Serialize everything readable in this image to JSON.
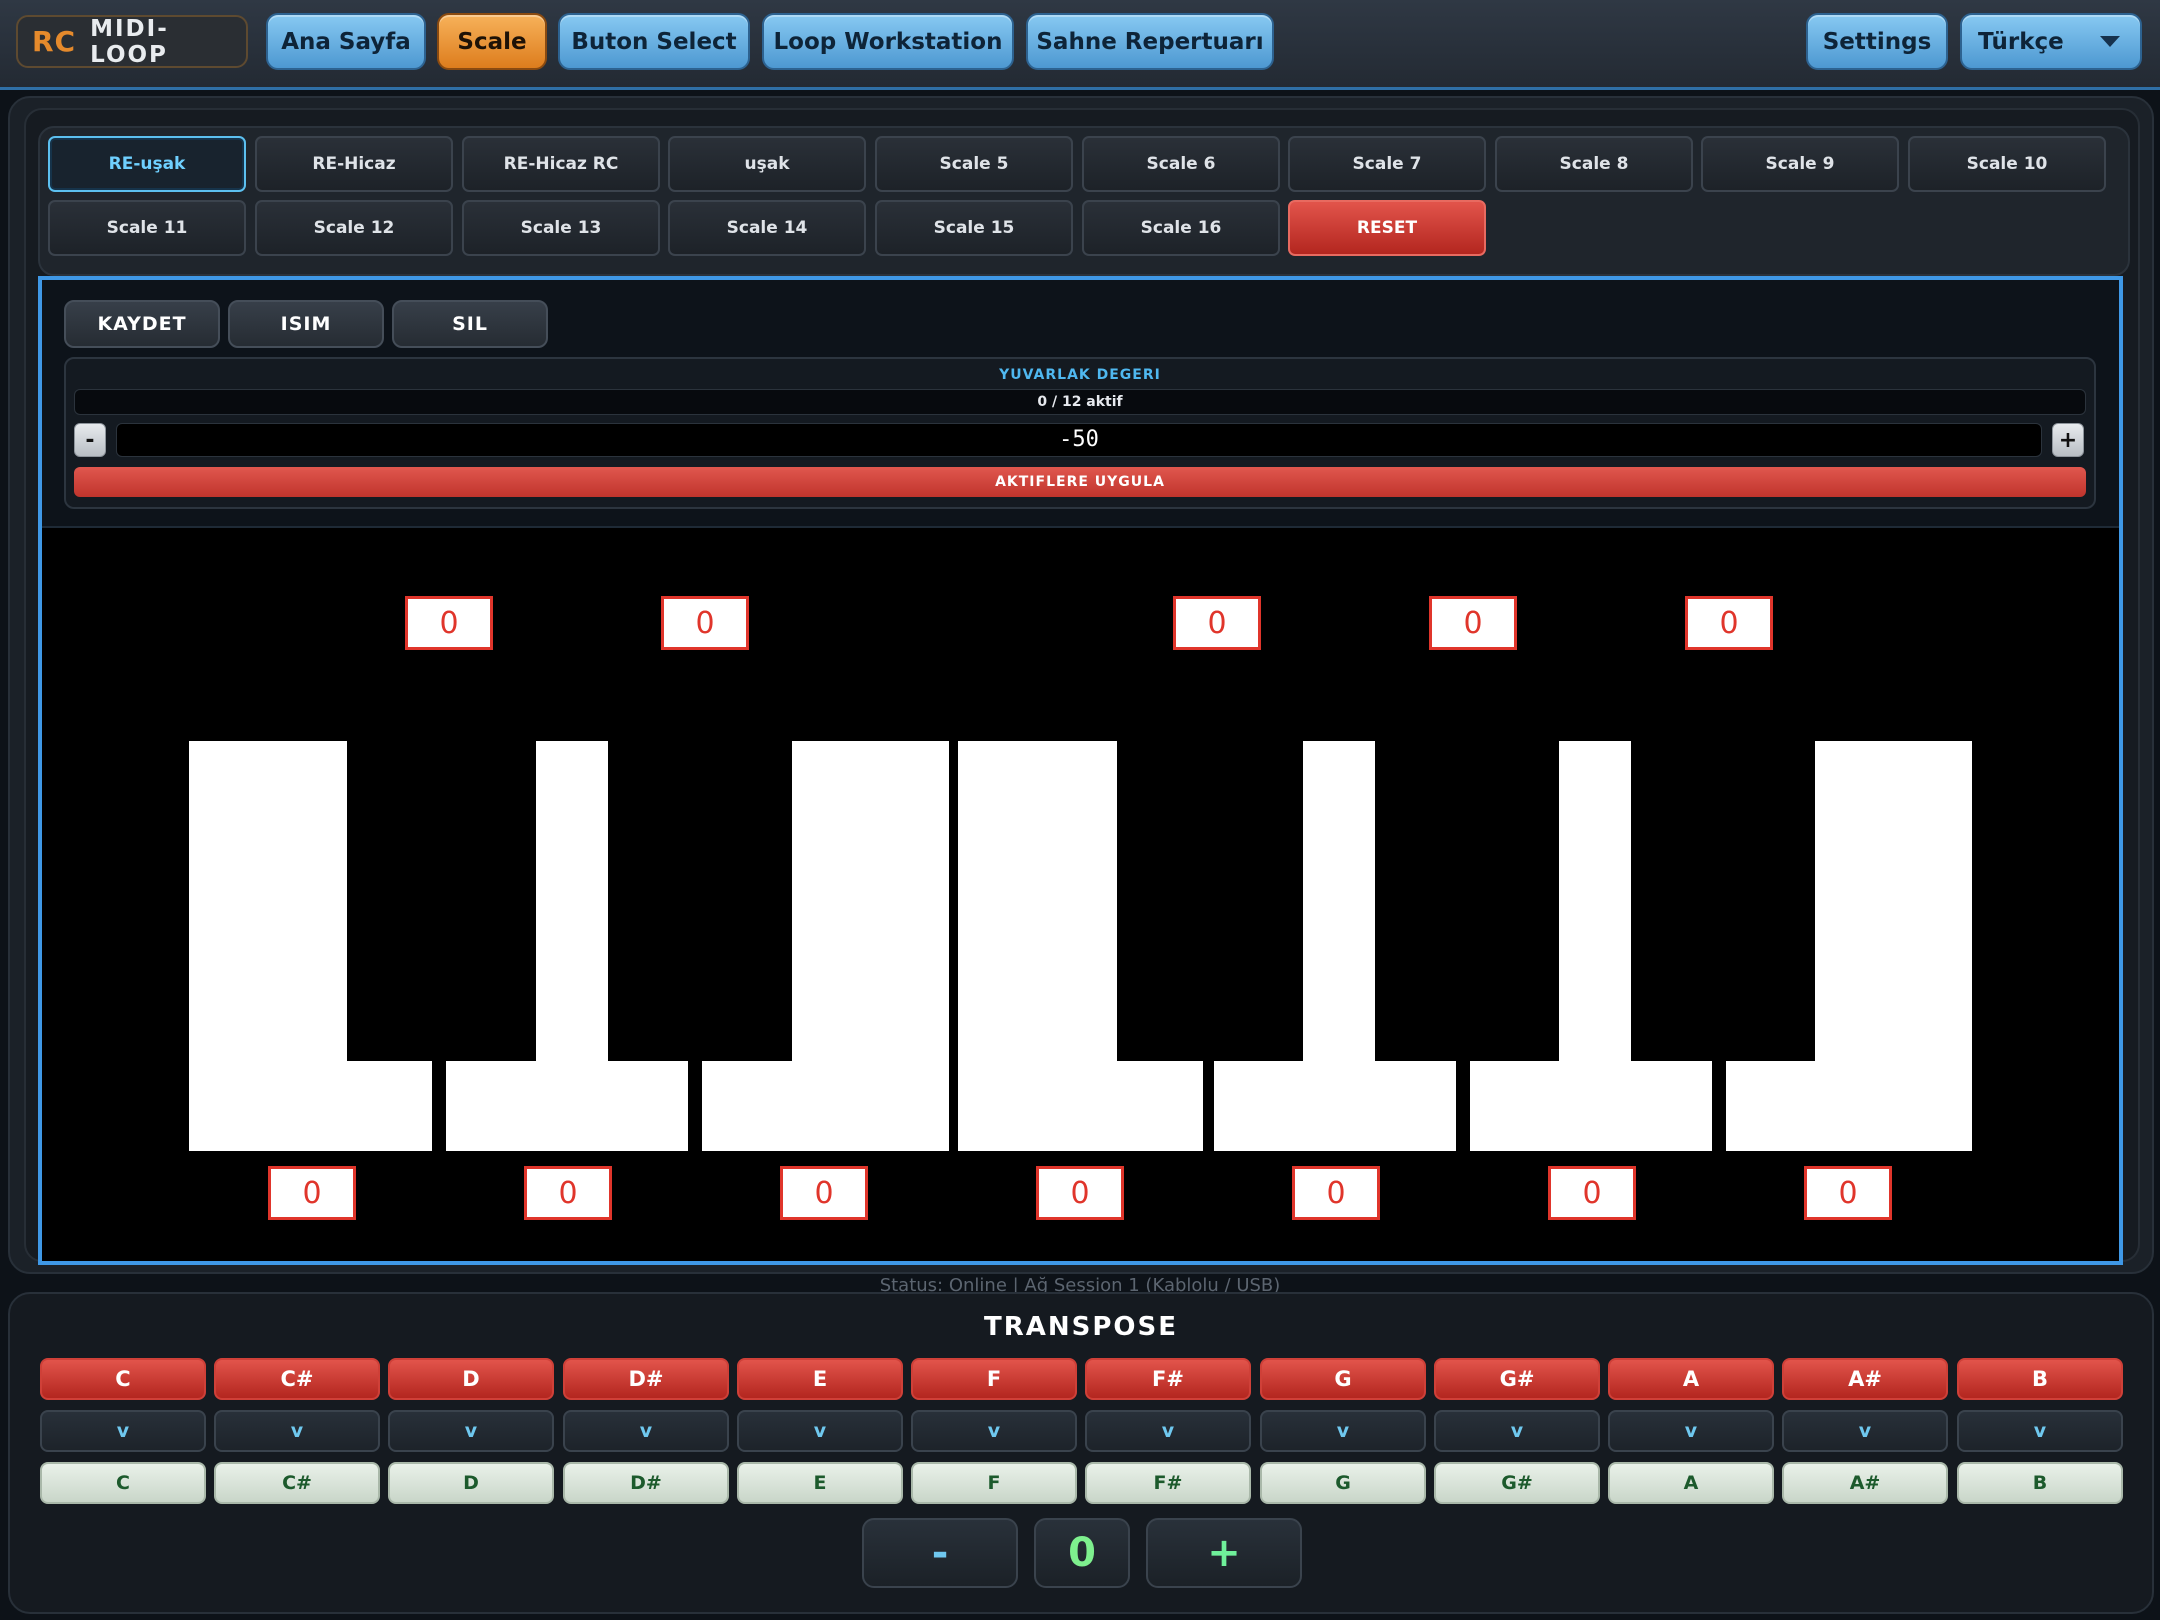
{
  "header": {
    "logo_rc": "RC",
    "logo_name": "MIDI-LOOP",
    "nav": [
      "Ana Sayfa",
      "Scale",
      "Buton Select",
      "Loop Workstation",
      "Sahne Repertuarı"
    ],
    "settings": "Settings",
    "language": "Türkçe"
  },
  "scales": {
    "row1": [
      "RE-uşak",
      "RE-Hicaz",
      "RE-Hicaz RC",
      "uşak",
      "Scale 5",
      "Scale 6",
      "Scale 7",
      "Scale 8",
      "Scale 9",
      "Scale 10"
    ],
    "row2": [
      "Scale 11",
      "Scale 12",
      "Scale 13",
      "Scale 14",
      "Scale 15",
      "Scale 16"
    ],
    "reset": "RESET"
  },
  "editor": {
    "save": "KAYDET",
    "name": "ISIM",
    "delete": "SIL",
    "yuvarlak_title": "YUVARLAK DEGERI",
    "active_count": "0 / 12 aktif",
    "minus": "-",
    "plus": "+",
    "value": "-50",
    "apply": "AKTIFLERE UYGULA",
    "black_key_values": [
      "0",
      "0",
      "0",
      "0",
      "0"
    ],
    "white_key_values": [
      "0",
      "0",
      "0",
      "0",
      "0",
      "0",
      "0"
    ]
  },
  "status": "Status: Online | Ağ Session 1 (Kablolu / USB)",
  "transpose": {
    "title": "TRANSPOSE",
    "notes": [
      "C",
      "C#",
      "D",
      "D#",
      "E",
      "F",
      "F#",
      "G",
      "G#",
      "A",
      "A#",
      "B"
    ],
    "arrow": "v",
    "targets": [
      "C",
      "C#",
      "D",
      "D#",
      "E",
      "F",
      "F#",
      "G",
      "G#",
      "A",
      "A#",
      "B"
    ],
    "minus": "-",
    "value": "0",
    "plus": "+"
  },
  "colors": {
    "accent_blue": "#3f98e6",
    "active_orange": "#dd7d1d",
    "reset_red": "#c0342c",
    "value_red": "#e0352b",
    "transpose_green": "#1c5a2c"
  }
}
